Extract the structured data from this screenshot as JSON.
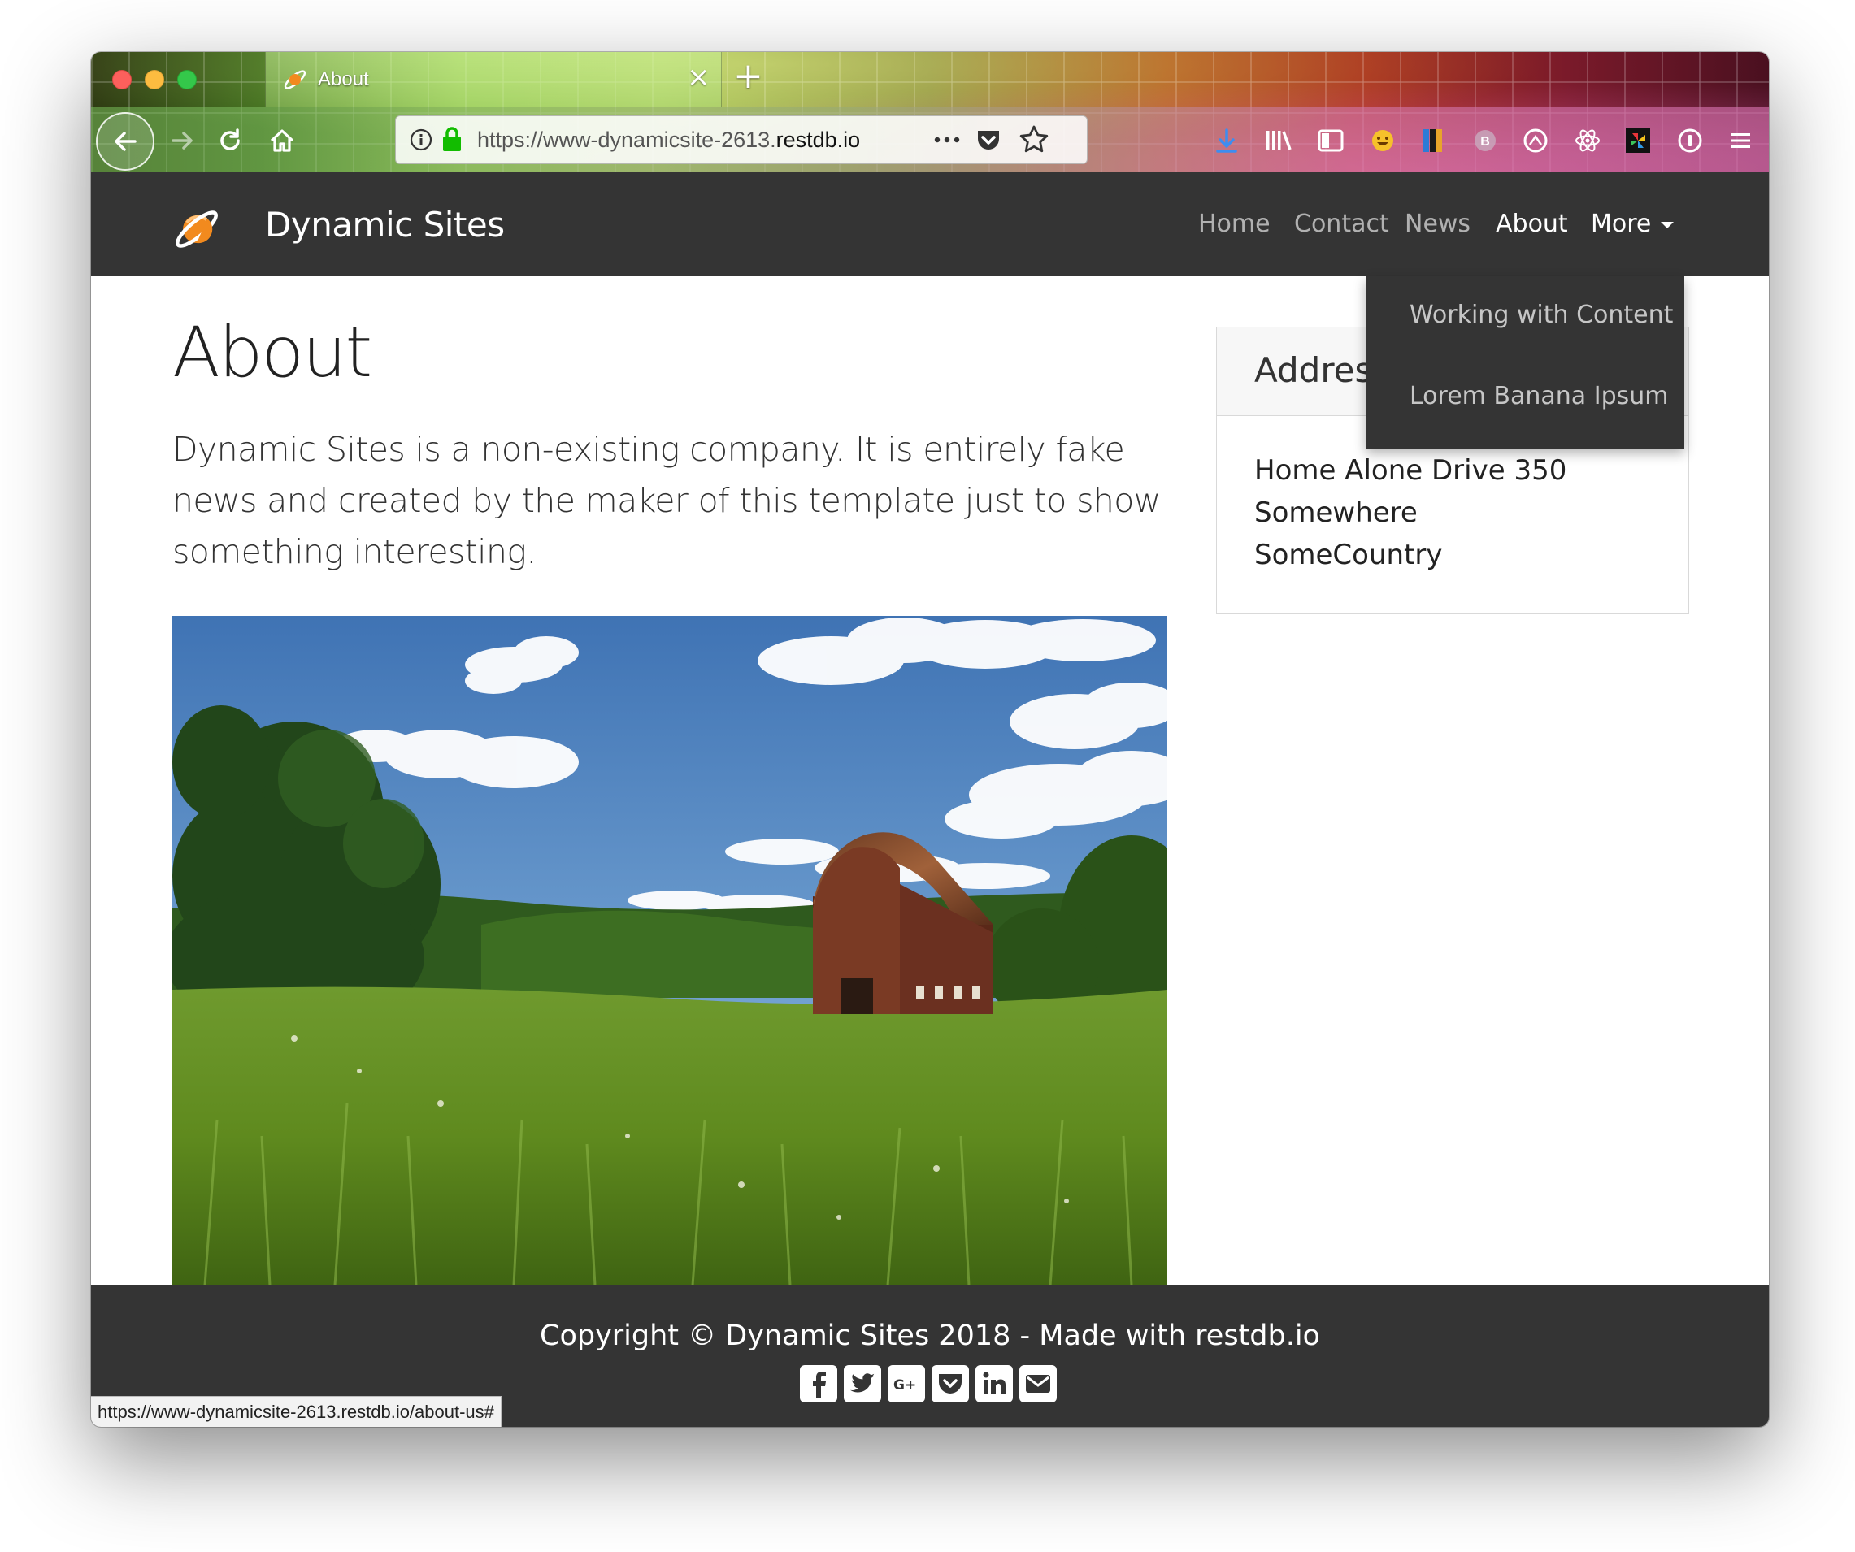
{
  "browser": {
    "tab_title": "About",
    "url_prefix": "https://www-dynamicsite-2613.",
    "url_domain": "restdb.io",
    "status_url": "https://www-dynamicsite-2613.restdb.io/about-us#"
  },
  "site": {
    "brand": "Dynamic Sites",
    "nav": [
      "Home",
      "Contact",
      "News",
      "About",
      "More"
    ],
    "active_nav": "About",
    "dropdown": [
      "Working with Content",
      "Lorem Banana Ipsum"
    ]
  },
  "main": {
    "title": "About",
    "lead": "Dynamic Sites is a non-existing company. It is entirely fake news and created by the maker of this template just to show something interesting."
  },
  "sidebar": {
    "card_title": "Address",
    "address_lines": [
      "Home Alone Drive 350",
      "Somewhere",
      "SomeCountry"
    ]
  },
  "footer": {
    "copyright": "Copyright © Dynamic Sites 2018 - Made with restdb.io",
    "social_icons": [
      "facebook-icon",
      "twitter-icon",
      "google-plus-icon",
      "pocket-icon",
      "linkedin-icon",
      "email-icon"
    ]
  },
  "colors": {
    "navbar_bg": "#343434",
    "brand_orange": "#f28a1e",
    "link_muted": "rgba(255,255,255,0.62)"
  }
}
